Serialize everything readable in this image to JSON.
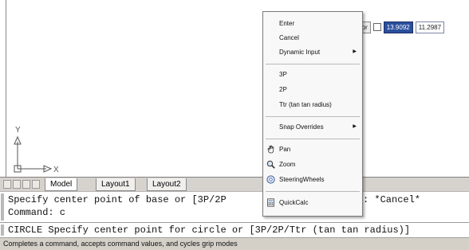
{
  "dynamic_input": {
    "prompt_fragment": "e or",
    "value_x": "13.9092",
    "value_y": "11.2987"
  },
  "ucs": {
    "y_label": "Y",
    "x_label": "X"
  },
  "tabs": {
    "items": [
      {
        "label": "Model"
      },
      {
        "label": "Layout1"
      },
      {
        "label": "Layout2"
      }
    ]
  },
  "command_history": {
    "lines": [
      "Specify center point of base or [3P/2P",
      "Command: c"
    ],
    "line1_tail": ": *Cancel*"
  },
  "command_line": {
    "text": "CIRCLE Specify center point for circle or [3P/2P/Ttr (tan tan radius)]"
  },
  "status_bar": {
    "text": "Completes a command, accepts command values, and cycles grip modes"
  },
  "context_menu": {
    "items": [
      {
        "label": "Enter"
      },
      {
        "label": "Cancel"
      },
      {
        "label": "Dynamic Input"
      },
      {
        "label": "3P"
      },
      {
        "label": "2P"
      },
      {
        "label": "Ttr (tan tan radius)"
      },
      {
        "label": "Snap Overrides"
      },
      {
        "label": "Pan"
      },
      {
        "label": "Zoom"
      },
      {
        "label": "SteeringWheels"
      },
      {
        "label": "QuickCalc"
      }
    ]
  },
  "colors": {
    "menu_background": "#f8f8f8",
    "selected_value_background": "#2a4f9d",
    "status_bar_background": "#d4d0c8"
  }
}
